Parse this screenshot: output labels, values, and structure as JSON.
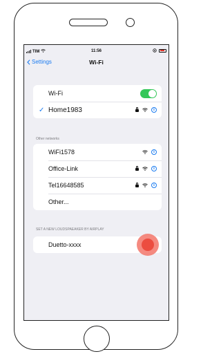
{
  "status_bar": {
    "carrier": "TIM",
    "time": "11:56"
  },
  "nav": {
    "back_label": "Settings",
    "title": "Wi-Fi"
  },
  "wifi": {
    "toggle_label": "Wi-Fi",
    "toggle_on": true,
    "connected_network": "Home1983"
  },
  "other_networks": {
    "header": "Other networks",
    "items": [
      {
        "name": "WiFi1578",
        "locked": false
      },
      {
        "name": "Office-Link",
        "locked": true
      },
      {
        "name": "Tel16648585",
        "locked": true
      }
    ],
    "other_label": "Other..."
  },
  "airplay": {
    "header": "SET A NEW LOUDSPAEAKER BY AIRPLAY",
    "device": "Duetto-xxxx"
  },
  "colors": {
    "accent": "#1a7bf0",
    "toggle_on": "#34c759",
    "tap_indicator": "#ea3a2c"
  }
}
